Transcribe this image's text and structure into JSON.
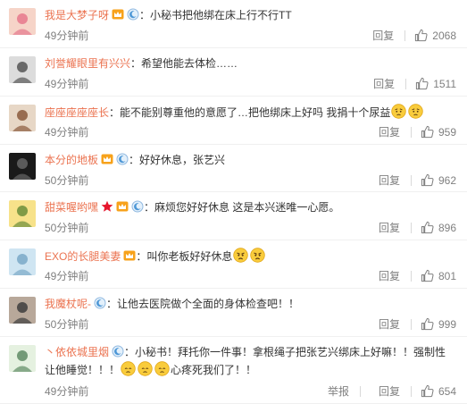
{
  "comments": [
    {
      "user": "我是大梦子呀",
      "text": "：小秘书把他绑在床上行不行TT",
      "time": "49分钟前",
      "reply": "回复",
      "likes": "2068",
      "avatar_colors": [
        "#f6d4c8",
        "#e6788c"
      ]
    },
    {
      "user": "刘誉耀眼里有兴兴",
      "text": "：希望他能去体检……",
      "time": "49分钟前",
      "reply": "回复",
      "likes": "1511",
      "avatar_colors": [
        "#dcdcdc",
        "#555555"
      ]
    },
    {
      "user": "座座座座座长",
      "text": "：能不能别尊重他的意愿了…把他绑床上好吗 我捐十个尿益",
      "time": "49分钟前",
      "reply": "回复",
      "likes": "959",
      "avatar_colors": [
        "#e7d7c6",
        "#8a5a3c"
      ]
    },
    {
      "user": "本分的地板",
      "text": "：好好休息，张艺兴",
      "time": "50分钟前",
      "reply": "回复",
      "likes": "962",
      "avatar_colors": [
        "#1a1a1a",
        "#666666"
      ]
    },
    {
      "user": "甜菜喔哟嘿",
      "text": "：麻烦您好好休息 这是本兴迷唯一心愿。",
      "time": "50分钟前",
      "reply": "回复",
      "likes": "896",
      "avatar_colors": [
        "#f7e28a",
        "#6b8e3a"
      ]
    },
    {
      "user": "EXO的长腿美妻",
      "text": "：叫你老板好好休息",
      "time": "49分钟前",
      "reply": "回复",
      "likes": "801",
      "avatar_colors": [
        "#cfe5f2",
        "#7aa9c8"
      ]
    },
    {
      "user": "我魔杖呢-",
      "text": "：让他去医院做个全面的身体检查吧！！",
      "time": "50分钟前",
      "reply": "回复",
      "likes": "999",
      "avatar_colors": [
        "#b8a89a",
        "#3d3d3d"
      ]
    },
    {
      "user": "丶依依城里烟",
      "text_line1": "：小秘书！拜托你一件事！拿根绳子把张艺兴绑床上好嘛！！强制性",
      "text_line2a": "让他睡觉！！！",
      "text_line2b": "心疼死我们了！！",
      "time": "49分钟前",
      "report": "举报",
      "reply": "回复",
      "likes": "654",
      "avatar_colors": [
        "#e5f1e0",
        "#5f8b64"
      ]
    }
  ],
  "icons": {
    "vip_badge": "crown-icon",
    "member_badge": "moon-badge-icon",
    "star_badge": "star-icon",
    "like": "thumbs-up-icon",
    "emoji_sad": "sad-face-emoji",
    "emoji_angry": "angry-face-emoji",
    "emoji_worried": "worried-face-emoji"
  },
  "colors": {
    "username": "#eb7350",
    "meta": "#808080",
    "text": "#333333",
    "star": "#e6162d"
  }
}
